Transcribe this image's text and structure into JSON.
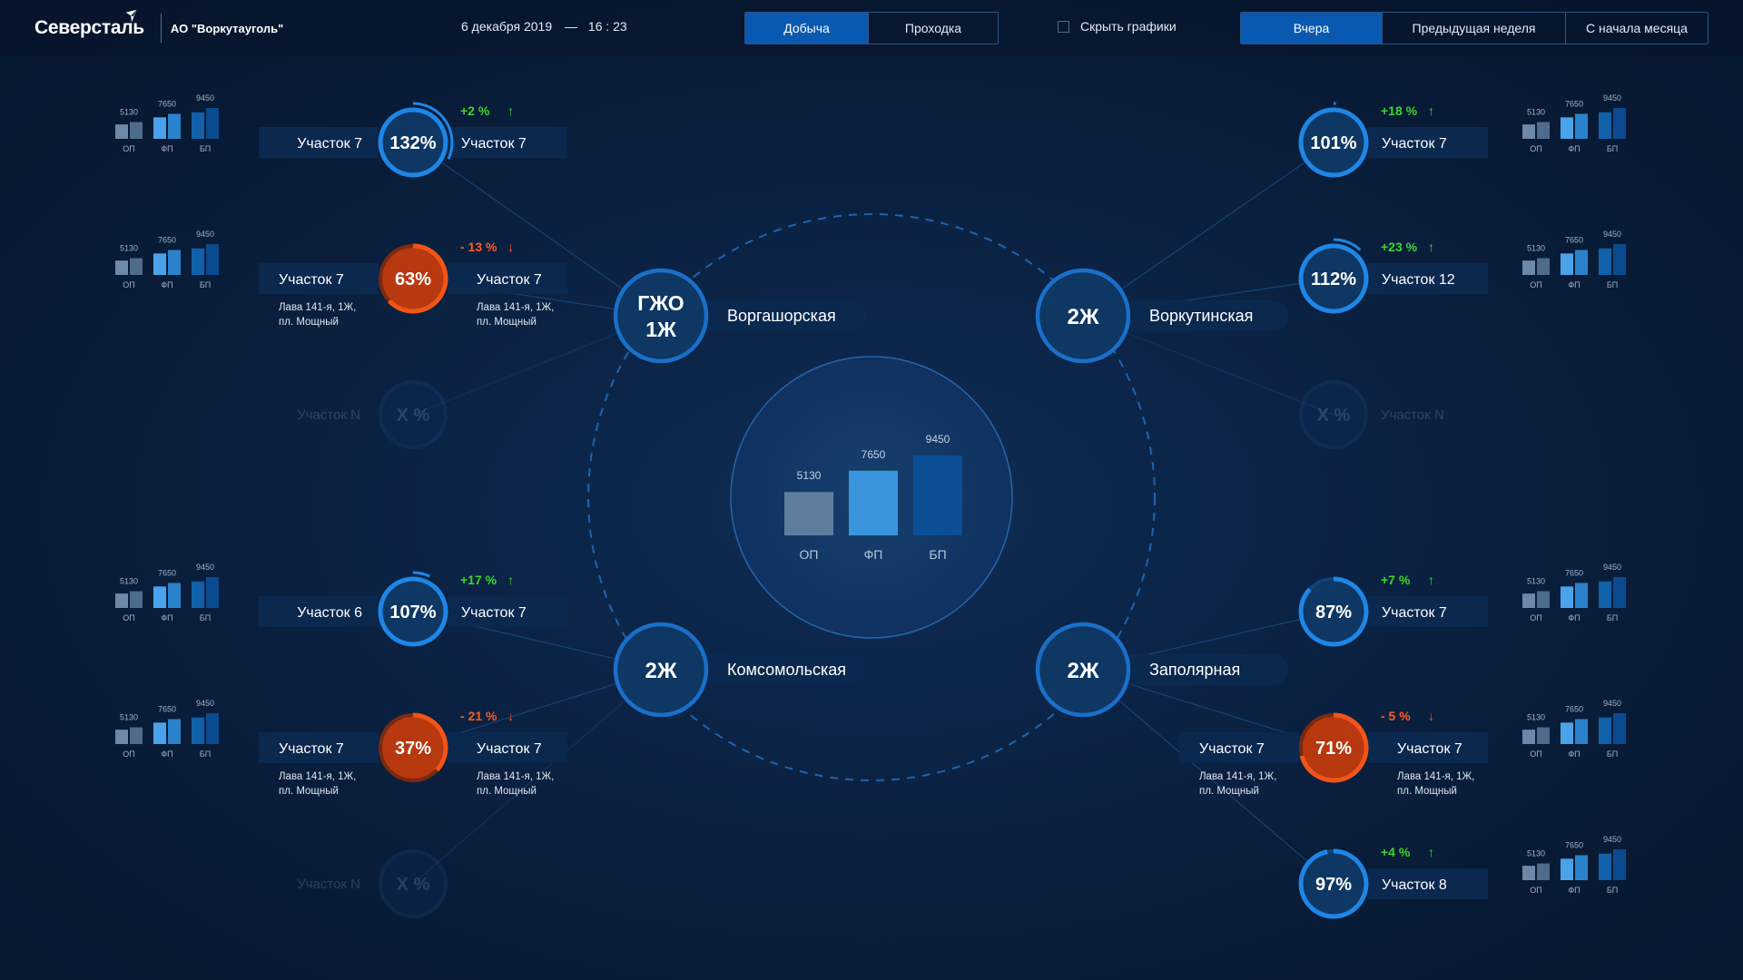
{
  "header": {
    "logo_text": "Северсталь",
    "company": "АО \"Воркутауголь\"",
    "date": "6 декабря 2019",
    "dash": "—",
    "time": "16 : 23",
    "mode_tabs": [
      {
        "label": "Добыча",
        "active": true
      },
      {
        "label": "Проходка",
        "active": false
      }
    ],
    "hide_charts": {
      "label": "Скрыть графики",
      "checked": false
    },
    "period_tabs": [
      {
        "label": "Вчера",
        "active": true
      },
      {
        "label": "Предыдущая неделя",
        "active": false
      },
      {
        "label": "С начала месяца",
        "active": false
      }
    ]
  },
  "colors": {
    "accent": "#0a59b0",
    "ring_blue": "#1e86e6",
    "node_fill": "#0e3763",
    "hub_border": "#1a6fc8",
    "red_fill": "#b8380f",
    "red_ring": "#f05517",
    "positive": "#3dd62e",
    "negative": "#ff5a27",
    "bar_op": "#5f7e9e",
    "bar_fp": "#3a95dd",
    "bar_bp": "#0c4f94"
  },
  "center_chart": {
    "categories": [
      "ОП",
      "ФП",
      "БП"
    ],
    "values": [
      5130,
      7650,
      9450
    ]
  },
  "mini_chart": {
    "categories": [
      "ОП",
      "ФП",
      "БП"
    ],
    "values": [
      5130,
      7650,
      9450
    ]
  },
  "mines": [
    {
      "id": "vorgashorskaya",
      "badge": "ГЖО\n1Ж",
      "name": "Воргашорская"
    },
    {
      "id": "vorkutinskaya",
      "badge": "2Ж",
      "name": "Воркутинская"
    },
    {
      "id": "komsomolskaya",
      "badge": "2Ж",
      "name": "Комсомольская"
    },
    {
      "id": "zapolyarnaya",
      "badge": "2Ж",
      "name": "Заполярная"
    }
  ],
  "sections": [
    {
      "mine": "vorgashorskaya",
      "value_text": "132%",
      "value_pct": 132,
      "status": "ok",
      "change": "+2 %",
      "change_dir": "up",
      "left_label": "Участок 7",
      "right_label": "Участок 7",
      "has_chart": true
    },
    {
      "mine": "vorgashorskaya",
      "value_text": "63%",
      "value_pct": 63,
      "status": "bad",
      "change": "- 13 %",
      "change_dir": "down",
      "left_label": "Участок 7",
      "left_sub1": "Лава 141-я, 1Ж,",
      "left_sub2": "пл. Мощный",
      "right_label": "Участок 7",
      "right_sub1": "Лава 141-я, 1Ж,",
      "right_sub2": "пл. Мощный",
      "has_chart": true
    },
    {
      "mine": "vorgashorskaya",
      "value_text": "X %",
      "status": "placeholder",
      "left_label": "Участок N",
      "has_chart": false
    },
    {
      "mine": "vorkutinskaya",
      "value_text": "101%",
      "value_pct": 101,
      "status": "ok",
      "change": "+18 %",
      "change_dir": "up",
      "right_label": "Участок 7",
      "has_chart": true
    },
    {
      "mine": "vorkutinskaya",
      "value_text": "112%",
      "value_pct": 112,
      "status": "ok",
      "change": "+23 %",
      "change_dir": "up",
      "right_label": "Участок 12",
      "has_chart": true
    },
    {
      "mine": "vorkutinskaya",
      "value_text": "X %",
      "status": "placeholder",
      "right_label": "Участок N",
      "has_chart": false
    },
    {
      "mine": "komsomolskaya",
      "value_text": "107%",
      "value_pct": 107,
      "status": "ok",
      "change": "+17 %",
      "change_dir": "up",
      "left_label": "Участок 6",
      "right_label": "Участок 7",
      "has_chart": true
    },
    {
      "mine": "komsomolskaya",
      "value_text": "37%",
      "value_pct": 37,
      "status": "bad",
      "change": "- 21 %",
      "change_dir": "down",
      "left_label": "Участок 7",
      "left_sub1": "Лава 141-я, 1Ж,",
      "left_sub2": "пл. Мощный",
      "right_label": "Участок 7",
      "right_sub1": "Лава 141-я, 1Ж,",
      "right_sub2": "пл. Мощный",
      "has_chart": true
    },
    {
      "mine": "komsomolskaya",
      "value_text": "X %",
      "status": "placeholder",
      "left_label": "Участок N",
      "has_chart": false
    },
    {
      "mine": "zapolyarnaya",
      "value_text": "87%",
      "value_pct": 87,
      "status": "ok",
      "change": "+7 %",
      "change_dir": "up",
      "right_label": "Участок 7",
      "has_chart": true
    },
    {
      "mine": "zapolyarnaya",
      "value_text": "71%",
      "value_pct": 71,
      "status": "bad",
      "change": "- 5 %",
      "change_dir": "down",
      "left_label": "Участок 7",
      "left_sub1": "Лава 141-я, 1Ж,",
      "left_sub2": "пл. Мощный",
      "right_label": "Участок 7",
      "right_sub1": "Лава 141-я, 1Ж,",
      "right_sub2": "пл. Мощный",
      "has_chart": true
    },
    {
      "mine": "zapolyarnaya",
      "value_text": "97%",
      "value_pct": 97,
      "status": "ok",
      "change": "+4 %",
      "change_dir": "up",
      "right_label": "Участок 8",
      "has_chart": true
    }
  ],
  "arrows": {
    "up": "↑",
    "down": "↓"
  }
}
